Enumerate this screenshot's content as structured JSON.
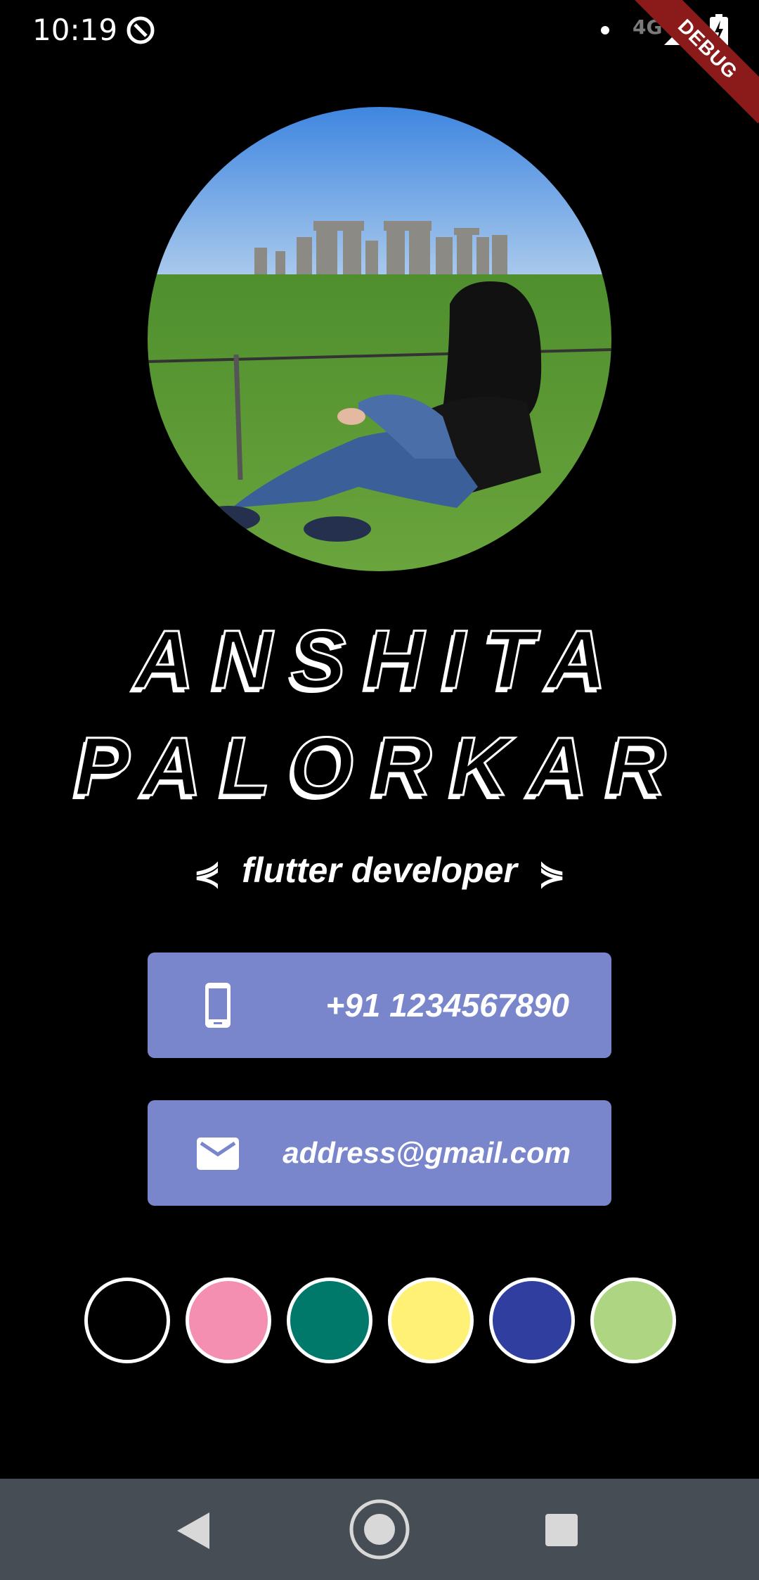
{
  "status_bar": {
    "time": "10:19",
    "network": "4G",
    "icons": [
      "do-not-disturb-icon",
      "signal-icon",
      "battery-charging-icon"
    ]
  },
  "debug_banner": "DEBUG",
  "profile": {
    "name_line_1": "ANSHITA",
    "name_line_2": "PALORKAR",
    "subtitle": "flutter developer",
    "subtitle_left_glyph": "⋞",
    "subtitle_right_glyph": "⋟"
  },
  "contact": {
    "phone": "+91 1234567890",
    "email": "address@gmail.com",
    "card_color": "#7986cb"
  },
  "color_swatches": [
    {
      "name": "black",
      "color": "#000000"
    },
    {
      "name": "pink",
      "color": "#f48fb1"
    },
    {
      "name": "teal",
      "color": "#00796b"
    },
    {
      "name": "yellow",
      "color": "#fff176"
    },
    {
      "name": "indigo",
      "color": "#303f9f"
    },
    {
      "name": "light-green",
      "color": "#aed581"
    }
  ],
  "nav_bar": {
    "buttons": [
      "back-icon",
      "home-icon",
      "recents-icon"
    ]
  }
}
